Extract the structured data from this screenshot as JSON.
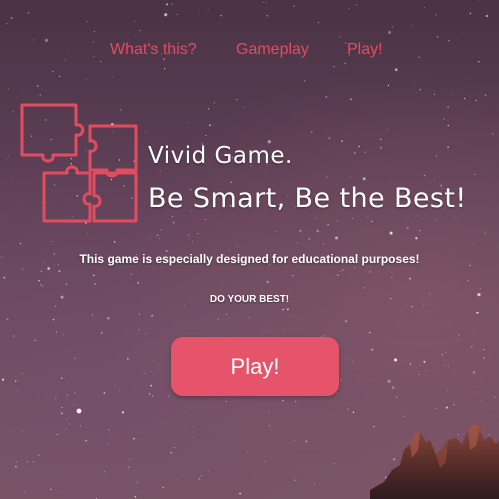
{
  "nav": {
    "items": [
      {
        "label": "What's this?"
      },
      {
        "label": "Gameplay"
      },
      {
        "label": "Play!"
      }
    ]
  },
  "hero": {
    "headline_line1": "Vivid Game.",
    "headline_line2": "Be Smart, Be the Best!",
    "tagline": "This game is especially designed for educational purposes!",
    "motto": "DO YOUR BEST!",
    "play_button_label": "Play!"
  },
  "colors": {
    "accent": "#e24c60",
    "button": "#e5546a",
    "text": "#ffffff",
    "background": "#5d3f55"
  },
  "icons": {
    "logo": "puzzle-pieces-icon"
  }
}
